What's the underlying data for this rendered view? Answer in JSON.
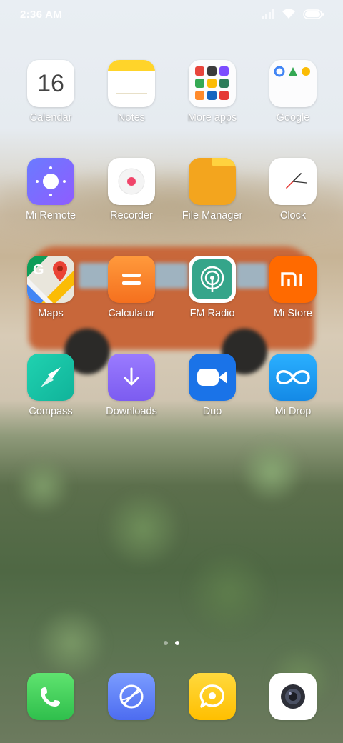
{
  "status_bar": {
    "time": "2:36 AM",
    "icons": [
      "signal-icon",
      "wifi-icon",
      "battery-icon"
    ]
  },
  "apps": {
    "calendar": {
      "label": "Calendar",
      "date": "16"
    },
    "notes": {
      "label": "Notes"
    },
    "more_apps": {
      "label": "More apps"
    },
    "google": {
      "label": "Google"
    },
    "mi_remote": {
      "label": "Mi Remote"
    },
    "recorder": {
      "label": "Recorder"
    },
    "file_manager": {
      "label": "File Manager"
    },
    "clock": {
      "label": "Clock"
    },
    "maps": {
      "label": "Maps"
    },
    "calculator": {
      "label": "Calculator"
    },
    "fm_radio": {
      "label": "FM Radio"
    },
    "mi_store": {
      "label": "Mi Store"
    },
    "compass": {
      "label": "Compass"
    },
    "downloads": {
      "label": "Downloads"
    },
    "duo": {
      "label": "Duo"
    },
    "mi_drop": {
      "label": "Mi Drop"
    }
  },
  "page_indicator": {
    "pages": 2,
    "current": 2
  },
  "dock": [
    "phone-icon",
    "browser-icon",
    "messaging-icon",
    "camera-icon"
  ],
  "colors": {
    "calculator": "#f57c2a",
    "file_manager": "#f3a51e",
    "mi_store": "#ff6a00",
    "compass": "#1bc3a3",
    "downloads": "#8b6cf0",
    "duo": "#1a73e8",
    "mi_drop": "#1e9bf0",
    "phone": "#3fc85a",
    "browser": "#5b7cf0",
    "messaging": "#ffcc1a"
  }
}
